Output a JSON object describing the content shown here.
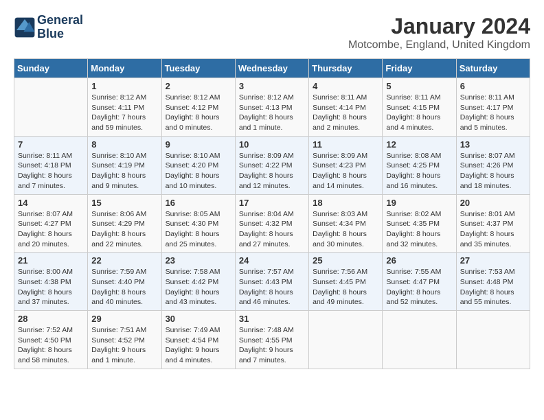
{
  "header": {
    "logo_line1": "General",
    "logo_line2": "Blue",
    "month_year": "January 2024",
    "location": "Motcombe, England, United Kingdom"
  },
  "days_of_week": [
    "Sunday",
    "Monday",
    "Tuesday",
    "Wednesday",
    "Thursday",
    "Friday",
    "Saturday"
  ],
  "weeks": [
    [
      {
        "day": "",
        "info": ""
      },
      {
        "day": "1",
        "info": "Sunrise: 8:12 AM\nSunset: 4:11 PM\nDaylight: 7 hours\nand 59 minutes."
      },
      {
        "day": "2",
        "info": "Sunrise: 8:12 AM\nSunset: 4:12 PM\nDaylight: 8 hours\nand 0 minutes."
      },
      {
        "day": "3",
        "info": "Sunrise: 8:12 AM\nSunset: 4:13 PM\nDaylight: 8 hours\nand 1 minute."
      },
      {
        "day": "4",
        "info": "Sunrise: 8:11 AM\nSunset: 4:14 PM\nDaylight: 8 hours\nand 2 minutes."
      },
      {
        "day": "5",
        "info": "Sunrise: 8:11 AM\nSunset: 4:15 PM\nDaylight: 8 hours\nand 4 minutes."
      },
      {
        "day": "6",
        "info": "Sunrise: 8:11 AM\nSunset: 4:17 PM\nDaylight: 8 hours\nand 5 minutes."
      }
    ],
    [
      {
        "day": "7",
        "info": "Sunrise: 8:11 AM\nSunset: 4:18 PM\nDaylight: 8 hours\nand 7 minutes."
      },
      {
        "day": "8",
        "info": "Sunrise: 8:10 AM\nSunset: 4:19 PM\nDaylight: 8 hours\nand 9 minutes."
      },
      {
        "day": "9",
        "info": "Sunrise: 8:10 AM\nSunset: 4:20 PM\nDaylight: 8 hours\nand 10 minutes."
      },
      {
        "day": "10",
        "info": "Sunrise: 8:09 AM\nSunset: 4:22 PM\nDaylight: 8 hours\nand 12 minutes."
      },
      {
        "day": "11",
        "info": "Sunrise: 8:09 AM\nSunset: 4:23 PM\nDaylight: 8 hours\nand 14 minutes."
      },
      {
        "day": "12",
        "info": "Sunrise: 8:08 AM\nSunset: 4:25 PM\nDaylight: 8 hours\nand 16 minutes."
      },
      {
        "day": "13",
        "info": "Sunrise: 8:07 AM\nSunset: 4:26 PM\nDaylight: 8 hours\nand 18 minutes."
      }
    ],
    [
      {
        "day": "14",
        "info": "Sunrise: 8:07 AM\nSunset: 4:27 PM\nDaylight: 8 hours\nand 20 minutes."
      },
      {
        "day": "15",
        "info": "Sunrise: 8:06 AM\nSunset: 4:29 PM\nDaylight: 8 hours\nand 22 minutes."
      },
      {
        "day": "16",
        "info": "Sunrise: 8:05 AM\nSunset: 4:30 PM\nDaylight: 8 hours\nand 25 minutes."
      },
      {
        "day": "17",
        "info": "Sunrise: 8:04 AM\nSunset: 4:32 PM\nDaylight: 8 hours\nand 27 minutes."
      },
      {
        "day": "18",
        "info": "Sunrise: 8:03 AM\nSunset: 4:34 PM\nDaylight: 8 hours\nand 30 minutes."
      },
      {
        "day": "19",
        "info": "Sunrise: 8:02 AM\nSunset: 4:35 PM\nDaylight: 8 hours\nand 32 minutes."
      },
      {
        "day": "20",
        "info": "Sunrise: 8:01 AM\nSunset: 4:37 PM\nDaylight: 8 hours\nand 35 minutes."
      }
    ],
    [
      {
        "day": "21",
        "info": "Sunrise: 8:00 AM\nSunset: 4:38 PM\nDaylight: 8 hours\nand 37 minutes."
      },
      {
        "day": "22",
        "info": "Sunrise: 7:59 AM\nSunset: 4:40 PM\nDaylight: 8 hours\nand 40 minutes."
      },
      {
        "day": "23",
        "info": "Sunrise: 7:58 AM\nSunset: 4:42 PM\nDaylight: 8 hours\nand 43 minutes."
      },
      {
        "day": "24",
        "info": "Sunrise: 7:57 AM\nSunset: 4:43 PM\nDaylight: 8 hours\nand 46 minutes."
      },
      {
        "day": "25",
        "info": "Sunrise: 7:56 AM\nSunset: 4:45 PM\nDaylight: 8 hours\nand 49 minutes."
      },
      {
        "day": "26",
        "info": "Sunrise: 7:55 AM\nSunset: 4:47 PM\nDaylight: 8 hours\nand 52 minutes."
      },
      {
        "day": "27",
        "info": "Sunrise: 7:53 AM\nSunset: 4:48 PM\nDaylight: 8 hours\nand 55 minutes."
      }
    ],
    [
      {
        "day": "28",
        "info": "Sunrise: 7:52 AM\nSunset: 4:50 PM\nDaylight: 8 hours\nand 58 minutes."
      },
      {
        "day": "29",
        "info": "Sunrise: 7:51 AM\nSunset: 4:52 PM\nDaylight: 9 hours\nand 1 minute."
      },
      {
        "day": "30",
        "info": "Sunrise: 7:49 AM\nSunset: 4:54 PM\nDaylight: 9 hours\nand 4 minutes."
      },
      {
        "day": "31",
        "info": "Sunrise: 7:48 AM\nSunset: 4:55 PM\nDaylight: 9 hours\nand 7 minutes."
      },
      {
        "day": "",
        "info": ""
      },
      {
        "day": "",
        "info": ""
      },
      {
        "day": "",
        "info": ""
      }
    ]
  ]
}
